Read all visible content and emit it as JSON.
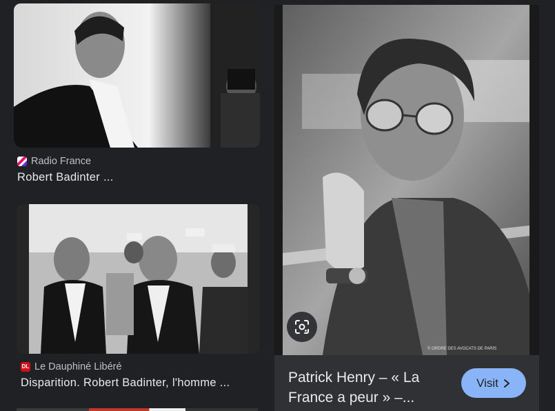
{
  "results": [
    {
      "source": "Radio France",
      "title": "Robert Badinter ...",
      "favicon": "radio-france-favicon"
    },
    {
      "source": "Le Dauphiné Libéré",
      "title": "Disparition. Robert Badinter, l'homme ...",
      "favicon": "dl-favicon",
      "favicon_text": "DL"
    }
  ],
  "preview": {
    "watermark": "© ORDRE DES AVOCATS DE PARIS",
    "title": "Patrick Henry – « La France a peur » –...",
    "visit_label": "Visit",
    "lens_icon": "lens-search-icon",
    "visit_icon": "chevron-right-icon"
  },
  "colors": {
    "background": "#202124",
    "panel": "#303134",
    "accent": "#8ab4f8"
  }
}
